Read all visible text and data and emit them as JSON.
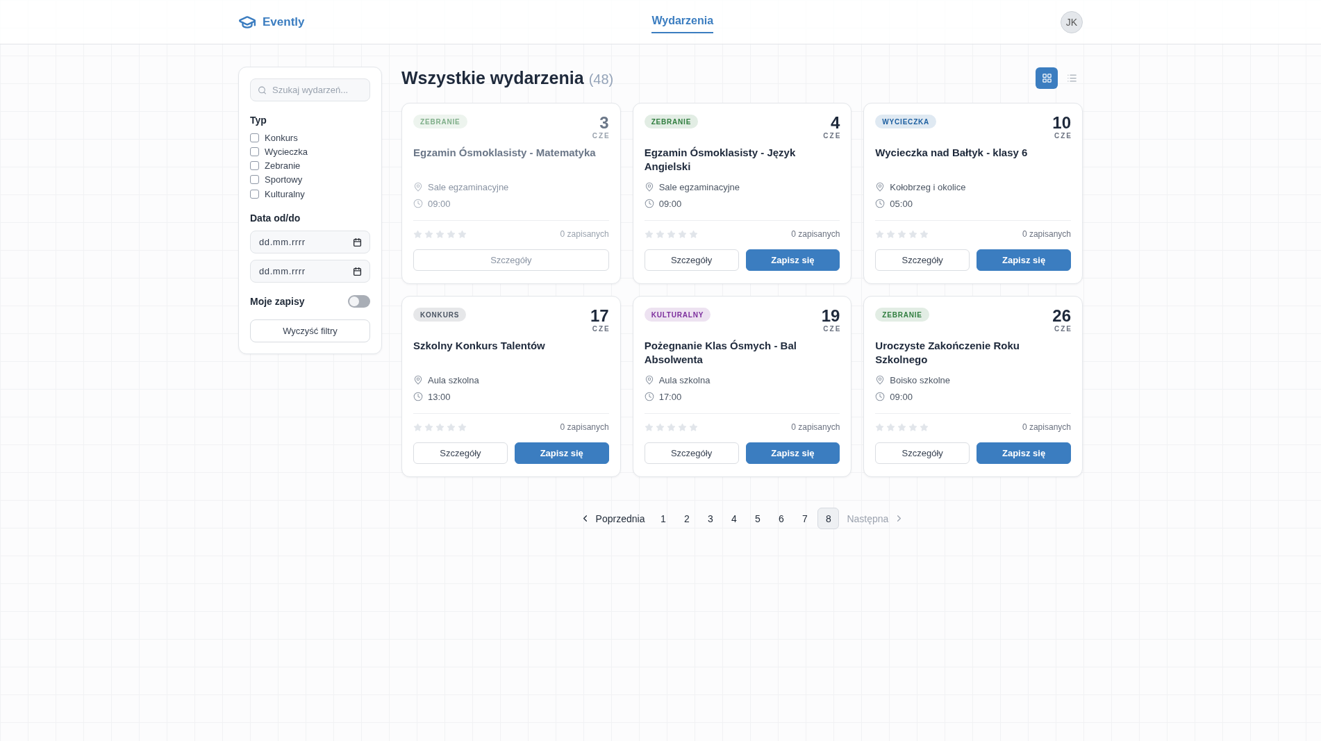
{
  "header": {
    "logo": {
      "name": "Evently"
    },
    "nav": [
      {
        "label": "Wydarzenia",
        "selected": true
      }
    ],
    "avatar": {
      "initials": "JK"
    }
  },
  "filters": {
    "search": {
      "placeholder": "Szukaj wydarzeń..."
    },
    "type_heading": "Typ",
    "types": [
      {
        "label": "Konkurs",
        "checked": false
      },
      {
        "label": "Wycieczka",
        "checked": false
      },
      {
        "label": "Zebranie",
        "checked": false
      },
      {
        "label": "Sportowy",
        "checked": false
      },
      {
        "label": "Kulturalny",
        "checked": false
      }
    ],
    "date_heading": "Data od/do",
    "date_fields": [
      {
        "placeholder": "dd.mm.rrrr"
      },
      {
        "placeholder": "dd.mm.rrrr"
      }
    ],
    "my_signups": {
      "label": "Moje zapisy",
      "on": false
    },
    "clear_button": "Wyczyść filtry"
  },
  "events": {
    "title": "Wszystkie wydarzenia",
    "count": "(48)",
    "view_modes": [
      {
        "kind": "grid",
        "selected": true
      },
      {
        "kind": "list",
        "selected": false
      }
    ],
    "cards": [
      {
        "category": {
          "label": "ZEBRANIE",
          "color": "#7fae89"
        },
        "day": "3",
        "month": "CZE",
        "title": "Egzamin Ósmoklasisty - Matematyka",
        "location": "Sale egzaminacyjne",
        "time": "09:00",
        "stars": 0,
        "signups": "0 zapisanych",
        "past": true,
        "buttons": [
          {
            "label": "Szczegóły",
            "kind": "outline"
          }
        ]
      },
      {
        "category": {
          "label": "ZEBRANIE",
          "color": "#2f7d3e"
        },
        "day": "4",
        "month": "CZE",
        "title": "Egzamin Ósmoklasisty - Język Angielski",
        "location": "Sale egzaminacyjne",
        "time": "09:00",
        "stars": 0,
        "signups": "0 zapisanych",
        "past": false,
        "buttons": [
          {
            "label": "Szczegóły",
            "kind": "outline"
          },
          {
            "label": "Zapisz się",
            "kind": "primary"
          }
        ]
      },
      {
        "category": {
          "label": "WYCIECZKA",
          "color": "#1d5fa0"
        },
        "day": "10",
        "month": "CZE",
        "title": "Wycieczka nad Bałtyk - klasy 6",
        "location": "Kołobrzeg i okolice",
        "time": "05:00",
        "stars": 0,
        "signups": "0 zapisanych",
        "past": false,
        "buttons": [
          {
            "label": "Szczegóły",
            "kind": "outline"
          },
          {
            "label": "Zapisz się",
            "kind": "primary"
          }
        ]
      },
      {
        "category": {
          "label": "KONKURS",
          "color": "#4b5563"
        },
        "day": "17",
        "month": "CZE",
        "title": "Szkolny Konkurs Talentów",
        "location": "Aula szkolna",
        "time": "13:00",
        "stars": 0,
        "signups": "0 zapisanych",
        "past": false,
        "buttons": [
          {
            "label": "Szczegóły",
            "kind": "outline"
          },
          {
            "label": "Zapisz się",
            "kind": "primary"
          }
        ]
      },
      {
        "category": {
          "label": "KULTURALNY",
          "color": "#7b2d9c"
        },
        "day": "19",
        "month": "CZE",
        "title": "Pożegnanie Klas Ósmych - Bal Absolwenta",
        "location": "Aula szkolna",
        "time": "17:00",
        "stars": 0,
        "signups": "0 zapisanych",
        "past": false,
        "buttons": [
          {
            "label": "Szczegóły",
            "kind": "outline"
          },
          {
            "label": "Zapisz się",
            "kind": "primary"
          }
        ]
      },
      {
        "category": {
          "label": "ZEBRANIE",
          "color": "#2f7d3e"
        },
        "day": "26",
        "month": "CZE",
        "title": "Uroczyste Zakończenie Roku Szkolnego",
        "location": "Boisko szkolne",
        "time": "09:00",
        "stars": 0,
        "signups": "0 zapisanych",
        "past": false,
        "buttons": [
          {
            "label": "Szczegóły",
            "kind": "outline"
          },
          {
            "label": "Zapisz się",
            "kind": "primary"
          }
        ]
      }
    ],
    "pagination": {
      "previous": {
        "label": "Poprzednia",
        "disabled": false
      },
      "pages": [
        {
          "label": "1",
          "selected": false
        },
        {
          "label": "2",
          "selected": false
        },
        {
          "label": "3",
          "selected": false
        },
        {
          "label": "4",
          "selected": false
        },
        {
          "label": "5",
          "selected": false
        },
        {
          "label": "6",
          "selected": false
        },
        {
          "label": "7",
          "selected": false
        },
        {
          "label": "8",
          "selected": true
        }
      ],
      "next": {
        "label": "Następna",
        "disabled": true
      }
    }
  }
}
